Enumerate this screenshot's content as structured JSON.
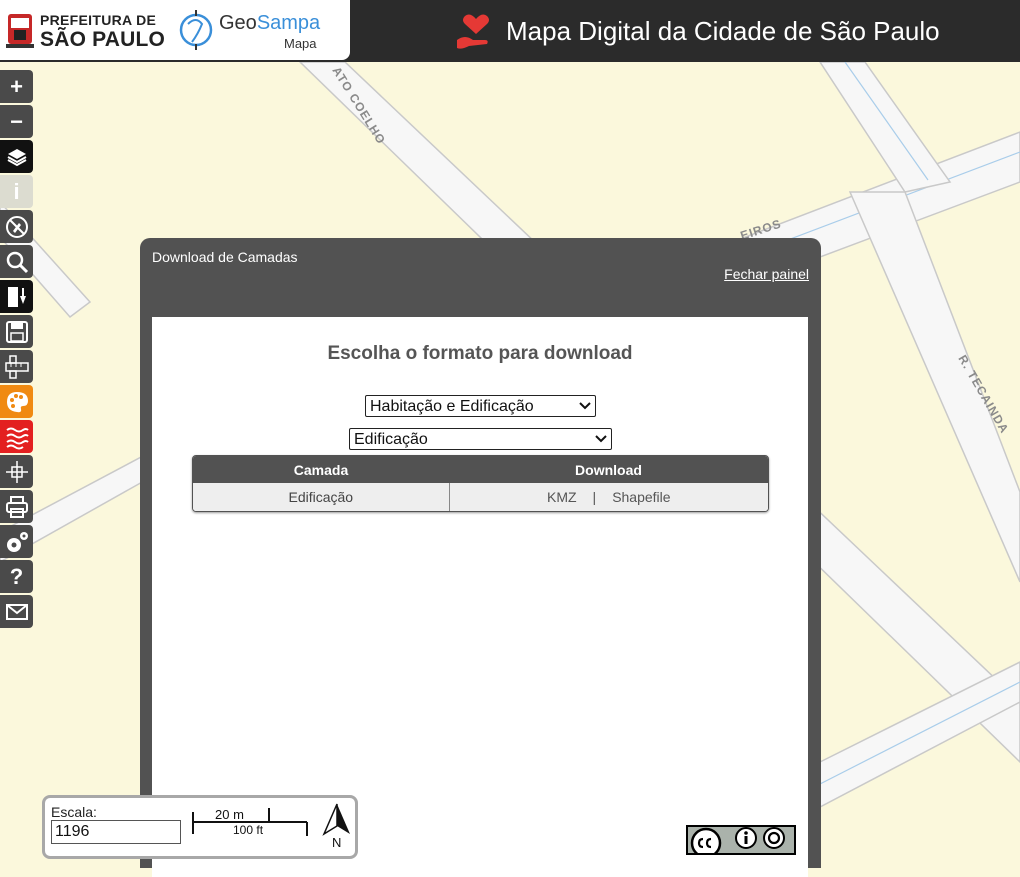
{
  "header": {
    "pref_line1": "PREFEITURA DE",
    "pref_line2": "SÃO PAULO",
    "geo_part1": "Geo",
    "geo_part2": "Sampa",
    "geo_sub": "Mapa",
    "title": "Mapa Digital da Cidade de São Paulo"
  },
  "map": {
    "street_labels": [
      "ATO COELHO",
      "EIROS",
      "R. TECAINDA"
    ]
  },
  "toolbar": {
    "zoom_in_label": "+",
    "zoom_out_label": "−",
    "info_label": "i",
    "help_label": "?"
  },
  "panel": {
    "title": "Download de Camadas",
    "close_label": "Fechar painel",
    "heading": "Escolha o formato para download",
    "select_theme": "Habitação e Edificação",
    "select_layer": "Edificação",
    "table": {
      "headers": [
        "Camada",
        "Download"
      ],
      "row": {
        "layer": "Edificação",
        "kmz": "KMZ",
        "separator": "|",
        "shapefile": "Shapefile"
      }
    }
  },
  "scale": {
    "label": "Escala:",
    "value": "1196",
    "bar_metric": "20 m",
    "bar_imperial": "100 ft",
    "north_label": "N"
  },
  "colors": {
    "header_bg": "#2b2b2b",
    "panel_bg": "#525252",
    "map_bg": "#fbf8dc",
    "accent_red": "#e53935",
    "accent_blue": "#3a8fd9",
    "tool_orange": "#f08a12",
    "tool_red": "#e32020"
  }
}
